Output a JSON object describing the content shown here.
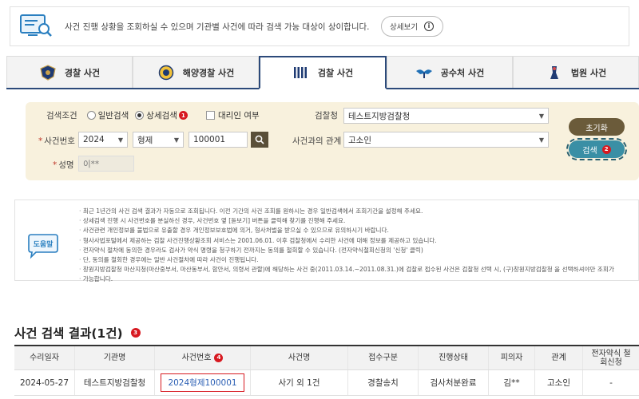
{
  "notice": {
    "text": "사건 진행 상황을 조회하실 수 있으며 기관별 사건에 따라 검색 가능 대상이 상이합니다.",
    "detail_button": "상세보기"
  },
  "tabs": [
    {
      "label": "경찰 사건",
      "icon": "police-emblem-icon"
    },
    {
      "label": "해양경찰 사건",
      "icon": "coast-guard-emblem-icon"
    },
    {
      "label": "검찰 사건",
      "icon": "prosecution-emblem-icon",
      "active": true
    },
    {
      "label": "공수처 사건",
      "icon": "cio-emblem-icon"
    },
    {
      "label": "법원 사건",
      "icon": "court-emblem-icon"
    }
  ],
  "search": {
    "condition_label": "검색조건",
    "option_general": "일반검색",
    "option_detail": "상세검색",
    "step1": "1",
    "proxy_label": "대리인 여부",
    "office_label": "검찰청",
    "office_value": "테스트지방검찰청",
    "case_no_label": "사건번호",
    "year_value": "2024",
    "type_value": "형제",
    "number_value": "100001",
    "relation_label": "사건과의 관계",
    "relation_value": "고소인",
    "name_label": "성명",
    "name_value": "이**",
    "reset_button": "초기화",
    "search_button": "검색",
    "step2": "2",
    "required_mark": "*"
  },
  "help": {
    "icon_label": "도움말",
    "items": [
      "최근 1년간의 사건 검색 결과가 자동으로 조회됩니다. 이전 기간의 사건 조회를 원하시는 경우 일반검색에서 조회기간을 설정해 주세요.",
      "상세검색 진행 시 사건번호를 분실하신 경우, 사건번호 옆 [돋보기] 버튼을 클릭해 찾기를 진행해 주세요.",
      "사건관련 개인정보를 불법으로 유출할 경우 개인정보보호법에 의거, 형사처벌을 받으실 수 있으므로 유의하시기 바랍니다.",
      "형사사법포털에서 제공하는 검찰 사건진행상황조회 서비스는 2001.06.01. 이후 검찰청에서 수리한 사건에 대해 정보를 제공하고 있습니다.",
      "전자약식 절차에 동의한 경우라도 검사가 약식 명령을 청구하기 전까지는 동의를 철회할 수 있습니다. (전자약식철회신청의 '신청' 클릭)",
      "단, 동의를 철회한 경우에는 일반 사건절차에 따라 사건이 진행됩니다.",
      "창원지방검찰청 마산지청(마산중부서, 마산동부서, 함안서, 의령서 관할)에 해당하는 사건 중(2011.03.14.~2011.08.31.)에 검찰로 접수된 사건은 검찰청 선택 시, (구)창원지방검찰청 을 선택하셔야만 조회가",
      "가능합니다."
    ]
  },
  "results": {
    "title": "사건 검색 결과(1건)",
    "step3": "3",
    "step4": "4",
    "headers": [
      "수리일자",
      "기관명",
      "사건번호",
      "사건명",
      "접수구분",
      "진행상태",
      "피의자",
      "관계",
      "전자약식 철회신청"
    ],
    "rows": [
      [
        "2024-05-27",
        "테스트지방검찰청",
        "2024형제100001",
        "사기 외 1건",
        "경찰송치",
        "검사처분완료",
        "김**",
        "고소인",
        "-"
      ]
    ]
  }
}
